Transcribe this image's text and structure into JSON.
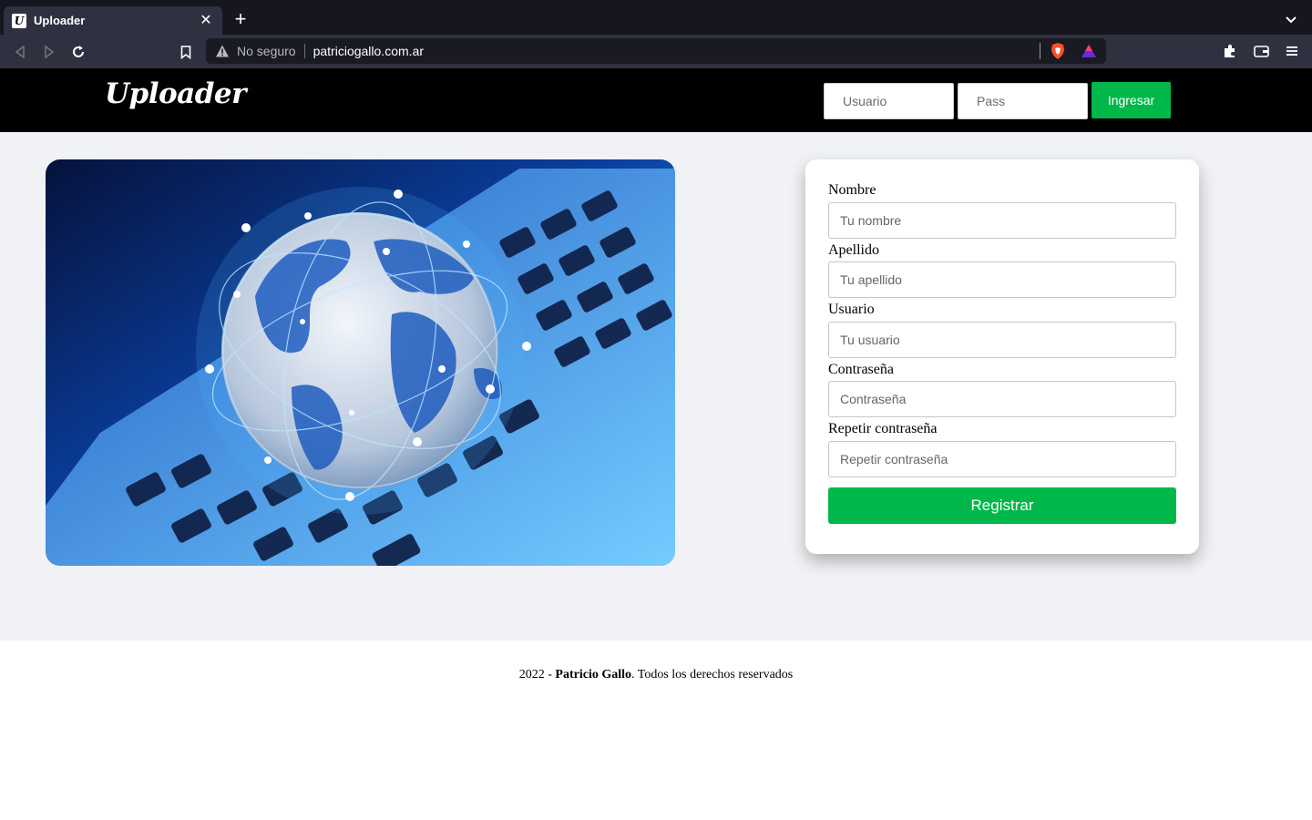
{
  "browser": {
    "tab": {
      "title": "Uploader",
      "favicon_icon": "uploader-favicon"
    },
    "address_bar": {
      "security_text": "No seguro",
      "url": "patriciogallo.com.ar"
    }
  },
  "header": {
    "logo": "Uploader",
    "login": {
      "user_placeholder": "Usuario",
      "pass_placeholder": "Pass",
      "button": "Ingresar"
    }
  },
  "hero": {
    "image_subject": "globe-over-laptop-keyboard"
  },
  "register_form": {
    "fields": [
      {
        "label": "Nombre",
        "placeholder": "Tu nombre"
      },
      {
        "label": "Apellido",
        "placeholder": "Tu apellido"
      },
      {
        "label": "Usuario",
        "placeholder": "Tu usuario"
      },
      {
        "label": "Contraseña",
        "placeholder": "Contraseña"
      },
      {
        "label": "Repetir contraseña",
        "placeholder": "Repetir contraseña"
      }
    ],
    "submit": "Registrar"
  },
  "footer": {
    "prefix": "2022 - ",
    "author": "Patricio Gallo",
    "suffix": ". Todos los derechos reservados"
  },
  "colors": {
    "accent_green": "#00b84a",
    "header_bg": "#000000",
    "page_bg": "#f0f2f5"
  }
}
